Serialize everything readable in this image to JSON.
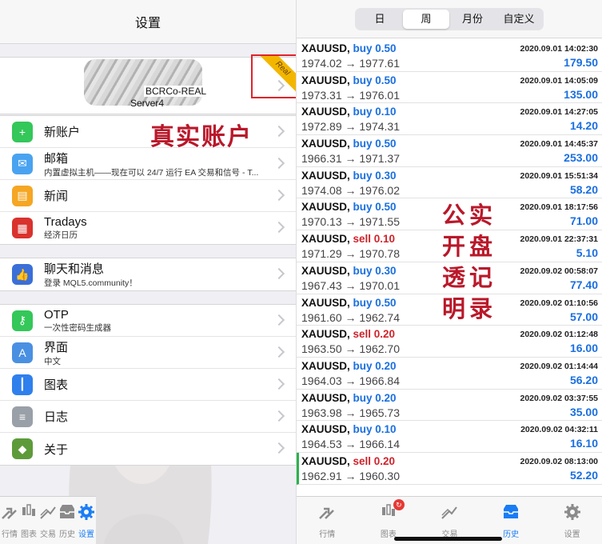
{
  "left": {
    "title": "设置",
    "account": {
      "name": "BCRCo-REAL",
      "server": "Server4",
      "ribbon": "Real"
    },
    "overlay_text": "真实账户",
    "group1": [
      {
        "title": "新账户",
        "subtitle": "",
        "icon": "add-user-icon",
        "color": "#34c759"
      },
      {
        "title": "邮箱",
        "subtitle": "内置虚拟主机——现在可以 24/7 运行 EA 交易和信号 - T...",
        "icon": "mail-icon",
        "color": "#4aa3f0"
      },
      {
        "title": "新闻",
        "subtitle": "",
        "icon": "book-icon",
        "color": "#f5a623"
      },
      {
        "title": "Tradays",
        "subtitle": "经济日历",
        "icon": "calendar-icon",
        "color": "#d9322e"
      }
    ],
    "group2": [
      {
        "title": "聊天和消息",
        "subtitle": "登录 MQL5.community！",
        "icon": "thumbs-up-icon",
        "color": "#3a6fd8"
      }
    ],
    "group3": [
      {
        "title": "OTP",
        "subtitle": "一次性密码生成器",
        "icon": "key-icon",
        "color": "#34c759"
      },
      {
        "title": "界面",
        "subtitle": "中文",
        "icon": "translate-icon",
        "color": "#4a90e2"
      },
      {
        "title": "图表",
        "subtitle": "",
        "icon": "candles-icon",
        "color": "#2f80ed"
      },
      {
        "title": "日志",
        "subtitle": "",
        "icon": "journal-icon",
        "color": "#9aa0a8"
      },
      {
        "title": "关于",
        "subtitle": "",
        "icon": "metatrader-icon",
        "color": "#5d9b3a"
      }
    ],
    "tabs": [
      {
        "label": "行情",
        "icon": "quotes-icon",
        "active": false
      },
      {
        "label": "图表",
        "icon": "chart-icon",
        "active": false
      },
      {
        "label": "交易",
        "icon": "trade-icon",
        "active": false
      },
      {
        "label": "历史",
        "icon": "history-icon",
        "active": false
      },
      {
        "label": "设置",
        "icon": "gear-icon",
        "active": true
      }
    ]
  },
  "right": {
    "segments": [
      {
        "label": "日",
        "active": false
      },
      {
        "label": "周",
        "active": true
      },
      {
        "label": "月份",
        "active": false
      },
      {
        "label": "自定义",
        "active": false
      }
    ],
    "overlay_cols": [
      [
        "公",
        "开",
        "透",
        "明"
      ],
      [
        "实",
        "盘",
        "记",
        "录"
      ]
    ],
    "deals": [
      {
        "symbol": "XAUUSD,",
        "side": "buy",
        "lot": "0.50",
        "open": "1974.02",
        "close": "1977.61",
        "time": "2020.09.01 14:02:30",
        "profit": "179.50"
      },
      {
        "symbol": "XAUUSD,",
        "side": "buy",
        "lot": "0.50",
        "open": "1973.31",
        "close": "1976.01",
        "time": "2020.09.01 14:05:09",
        "profit": "135.00"
      },
      {
        "symbol": "XAUUSD,",
        "side": "buy",
        "lot": "0.10",
        "open": "1972.89",
        "close": "1974.31",
        "time": "2020.09.01 14:27:05",
        "profit": "14.20"
      },
      {
        "symbol": "XAUUSD,",
        "side": "buy",
        "lot": "0.50",
        "open": "1966.31",
        "close": "1971.37",
        "time": "2020.09.01 14:45:37",
        "profit": "253.00"
      },
      {
        "symbol": "XAUUSD,",
        "side": "buy",
        "lot": "0.30",
        "open": "1974.08",
        "close": "1976.02",
        "time": "2020.09.01 15:51:34",
        "profit": "58.20"
      },
      {
        "symbol": "XAUUSD,",
        "side": "buy",
        "lot": "0.50",
        "open": "1970.13",
        "close": "1971.55",
        "time": "2020.09.01 18:17:56",
        "profit": "71.00"
      },
      {
        "symbol": "XAUUSD,",
        "side": "sell",
        "lot": "0.10",
        "open": "1971.29",
        "close": "1970.78",
        "time": "2020.09.01 22:37:31",
        "profit": "5.10"
      },
      {
        "symbol": "XAUUSD,",
        "side": "buy",
        "lot": "0.30",
        "open": "1967.43",
        "close": "1970.01",
        "time": "2020.09.02 00:58:07",
        "profit": "77.40"
      },
      {
        "symbol": "XAUUSD,",
        "side": "buy",
        "lot": "0.50",
        "open": "1961.60",
        "close": "1962.74",
        "time": "2020.09.02 01:10:56",
        "profit": "57.00"
      },
      {
        "symbol": "XAUUSD,",
        "side": "sell",
        "lot": "0.20",
        "open": "1963.50",
        "close": "1962.70",
        "time": "2020.09.02 01:12:48",
        "profit": "16.00"
      },
      {
        "symbol": "XAUUSD,",
        "side": "buy",
        "lot": "0.20",
        "open": "1964.03",
        "close": "1966.84",
        "time": "2020.09.02 01:14:44",
        "profit": "56.20"
      },
      {
        "symbol": "XAUUSD,",
        "side": "buy",
        "lot": "0.20",
        "open": "1963.98",
        "close": "1965.73",
        "time": "2020.09.02 03:37:55",
        "profit": "35.00"
      },
      {
        "symbol": "XAUUSD,",
        "side": "buy",
        "lot": "0.10",
        "open": "1964.53",
        "close": "1966.14",
        "time": "2020.09.02 04:32:11",
        "profit": "16.10"
      },
      {
        "symbol": "XAUUSD,",
        "side": "sell",
        "lot": "0.20",
        "open": "1962.91",
        "close": "1960.30",
        "time": "2020.09.02 08:13:00",
        "profit": "52.20",
        "marked": true
      }
    ],
    "tabs": [
      {
        "label": "行情",
        "icon": "quotes-icon",
        "active": false
      },
      {
        "label": "图表",
        "icon": "chart-icon",
        "active": false
      },
      {
        "label": "交易",
        "icon": "trade-icon",
        "active": false
      },
      {
        "label": "历史",
        "icon": "history-icon",
        "active": true
      },
      {
        "label": "设置",
        "icon": "gear-icon",
        "active": false
      }
    ]
  }
}
